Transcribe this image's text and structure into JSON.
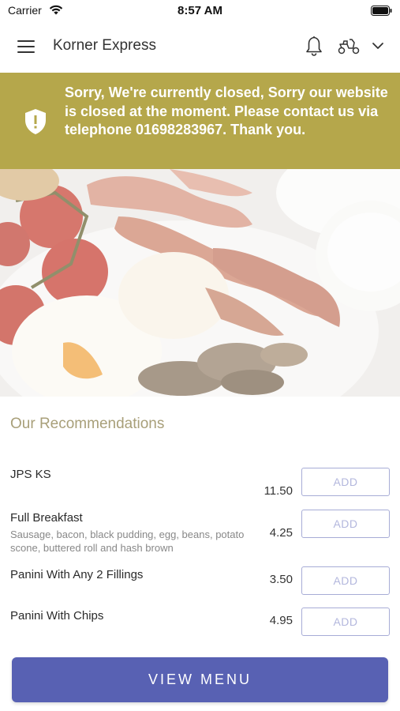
{
  "status_bar": {
    "carrier": "Carrier",
    "time": "8:57 AM"
  },
  "header": {
    "title": "Korner Express",
    "icons": [
      "menu-icon",
      "bell-icon",
      "scooter-icon",
      "chevron-down-icon"
    ]
  },
  "banner": {
    "message": "Sorry, We're currently closed, Sorry our website is closed at the moment. Please contact us via telephone 01698283967. Thank you.",
    "color": "#b5a74b",
    "icon": "shield-alert-icon"
  },
  "hero": {
    "image": "breakfast-plate-photo"
  },
  "recommendations": {
    "title": "Our Recommendations",
    "items": [
      {
        "name": "JPS KS",
        "description": "",
        "price": "11.50",
        "add_label": "ADD"
      },
      {
        "name": "Full Breakfast",
        "description": "Sausage, bacon, black pudding, egg, beans, potato scone, buttered roll and hash brown",
        "price": "4.25",
        "add_label": "ADD"
      },
      {
        "name": "Panini With Any 2 Fillings",
        "description": "",
        "price": "3.50",
        "add_label": "ADD"
      },
      {
        "name": "Panini With Chips",
        "description": "",
        "price": "4.95",
        "add_label": "ADD"
      }
    ]
  },
  "footer": {
    "view_menu_label": "VIEW MENU",
    "accent": "#5861b3"
  }
}
